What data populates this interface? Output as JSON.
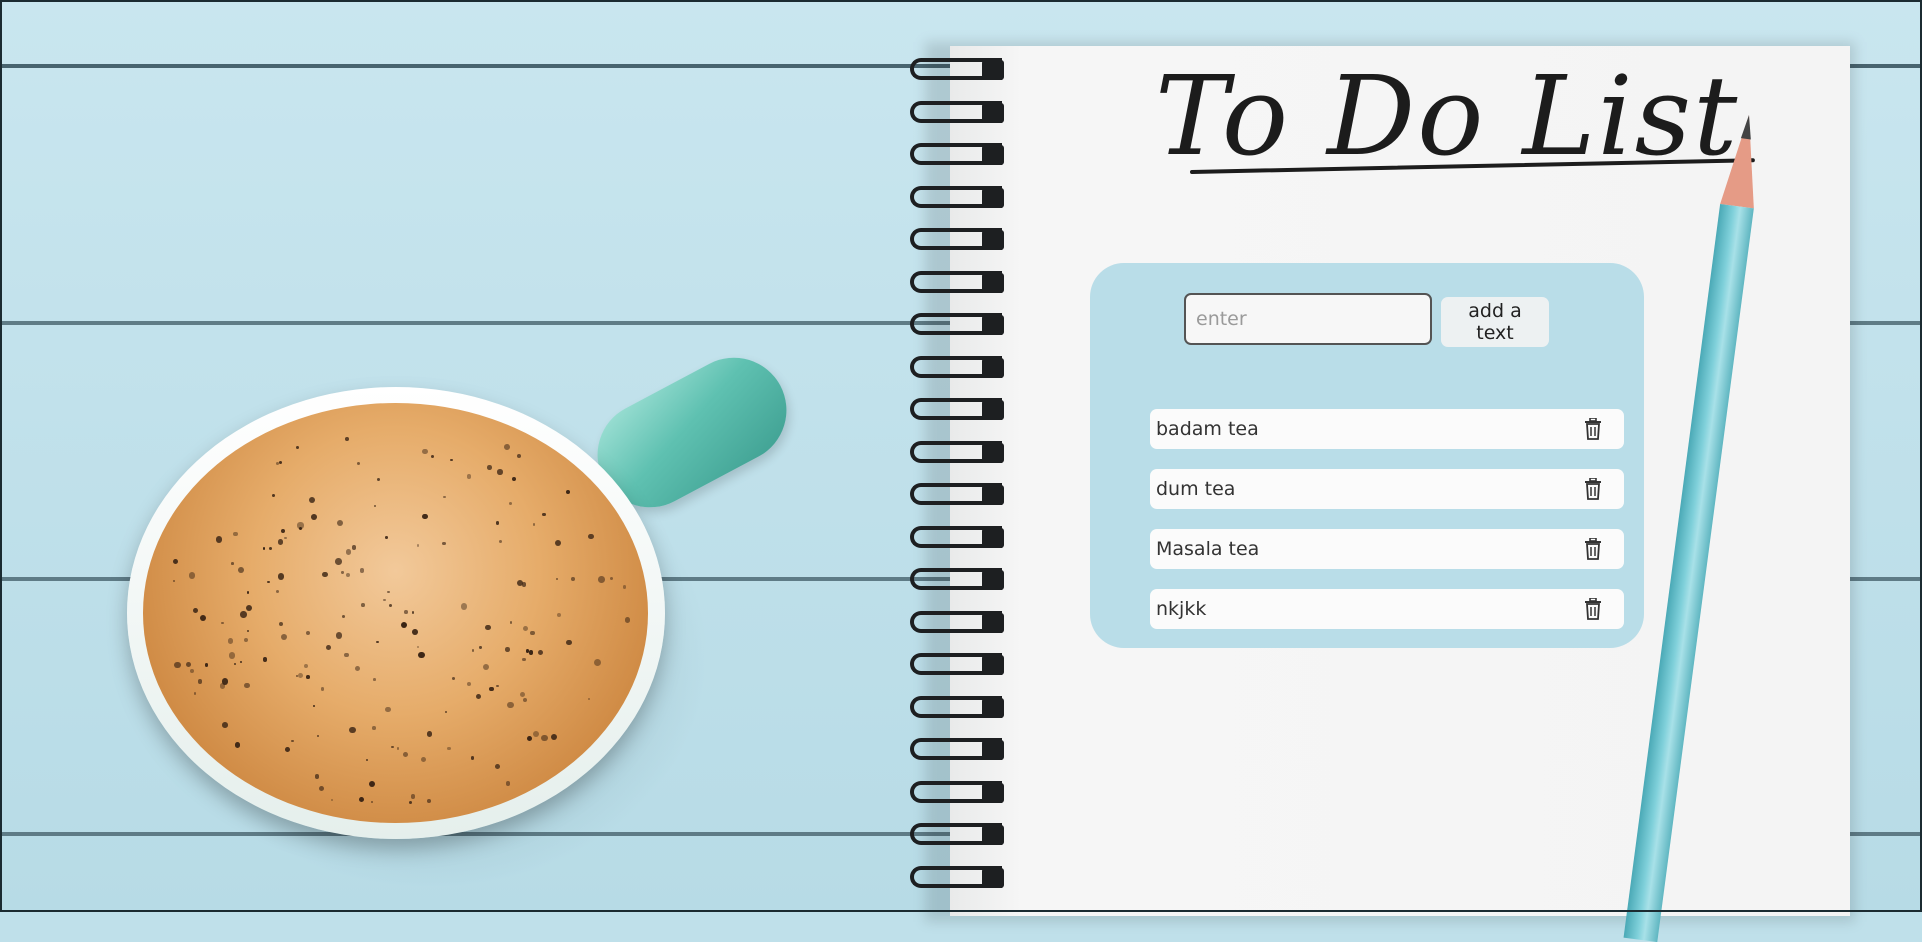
{
  "page": {
    "title": "To Do List"
  },
  "form": {
    "input_placeholder": "enter",
    "input_value": "",
    "add_button_label": "add a text"
  },
  "todos": [
    {
      "label": "badam tea",
      "icon": "trash-icon"
    },
    {
      "label": "dum tea",
      "icon": "trash-icon"
    },
    {
      "label": "Masala tea",
      "icon": "trash-icon"
    },
    {
      "label": "nkjkk",
      "icon": "trash-icon"
    }
  ],
  "colors": {
    "card_background": "#b9dde8",
    "item_background": "#fbfbfb",
    "background_planks": "#bfe0ea"
  }
}
